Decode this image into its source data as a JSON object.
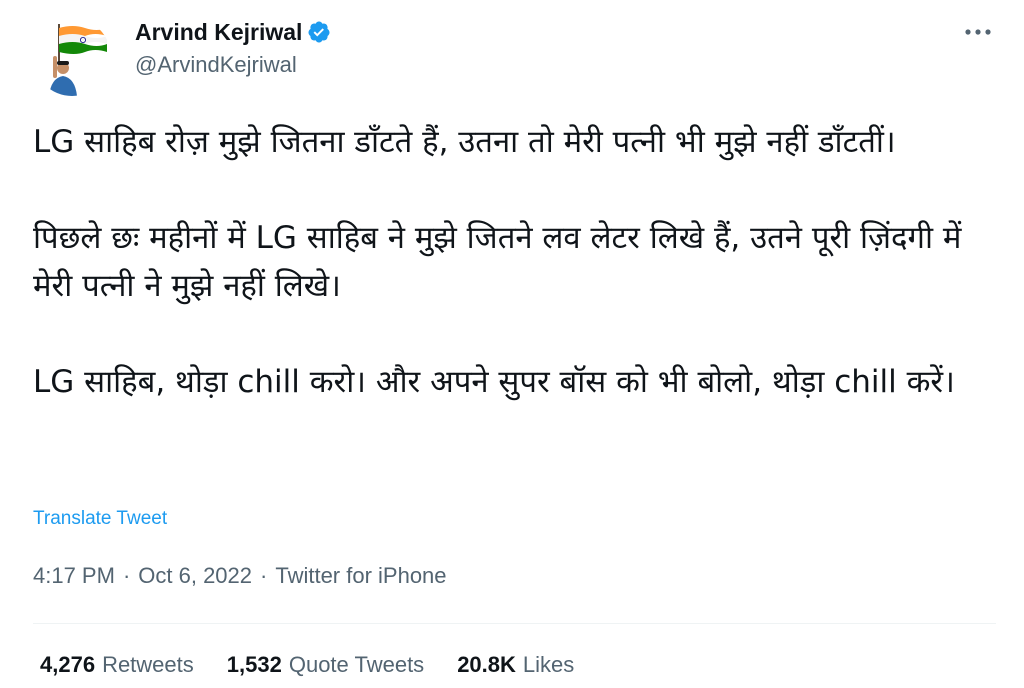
{
  "author": {
    "name": "Arvind Kejriwal",
    "handle": "@ArvindKejriwal",
    "verified_color": "#1d9bf0"
  },
  "more_icon": "more-horizontal-icon",
  "tweet": {
    "paragraphs": [
      "LG साहिब रोज़ मुझे जितना डाँटते हैं, उतना तो मेरी पत्नी भी मुझे नहीं डाँटतीं।",
      "पिछले छः महीनों में LG साहिब ने मुझे जितने लव लेटर लिखे हैं, उतने पूरी ज़िंदगी में मेरी पत्नी ने मुझे नहीं लिखे।",
      "LG साहिब, थोड़ा chill करो। और अपने सुपर बॉस को भी बोलो, थोड़ा chill करें।"
    ],
    "translate_label": "Translate Tweet"
  },
  "meta": {
    "time": "4:17 PM",
    "sep1": "·",
    "date": "Oct 6, 2022",
    "sep2": "·",
    "source": "Twitter for iPhone"
  },
  "stats": {
    "retweets_count": "4,276",
    "retweets_label": "Retweets",
    "quotes_count": "1,532",
    "quotes_label": "Quote Tweets",
    "likes_count": "20.8K",
    "likes_label": "Likes"
  },
  "colors": {
    "link": "#1d9bf0",
    "secondary_text": "#536471",
    "primary_text": "#0f1419",
    "flag_saffron": "#FF9933",
    "flag_green": "#138808",
    "flag_chakra": "#000080"
  }
}
